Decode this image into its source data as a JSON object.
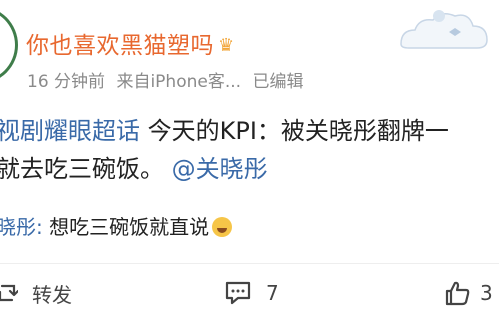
{
  "post": {
    "author": "你也喜欢黑猫塑吗",
    "crown_icon": "crown-icon",
    "time": "16 分钟前",
    "source": "来自iPhone客...",
    "edited": "已编辑",
    "topic": "视剧耀眼超话",
    "text_part1": "今天的KPI：被关晓彤翻牌一",
    "text_line2": "就去吃三碗饭。",
    "mention": "@关晓彤"
  },
  "comment": {
    "author": "晓彤:",
    "text": "想吃三碗饭就直说",
    "emoji_icon": "crying-face-icon"
  },
  "actions": {
    "repost_label": "转发",
    "comment_count": "7",
    "like_count": "3"
  },
  "colors": {
    "username": "#e8682f",
    "link": "#3a6aa8",
    "meta": "#8a8a8a"
  }
}
